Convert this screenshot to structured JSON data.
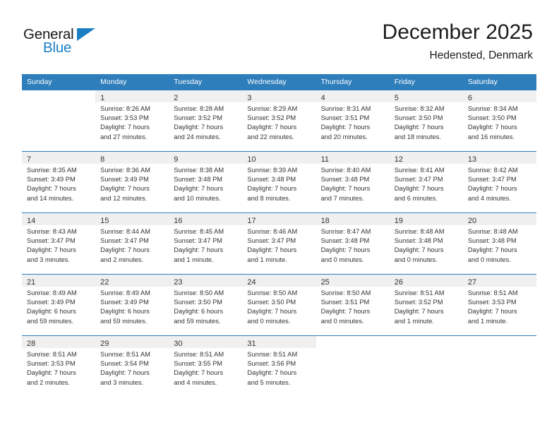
{
  "logo": {
    "word_top": "General",
    "word_bottom": "Blue",
    "triangle_color": "#1c7fc4"
  },
  "header": {
    "title": "December 2025",
    "subtitle": "Hedensted, Denmark"
  },
  "theme": {
    "header_blue": "#2e7ebb",
    "daynum_shade": "#f0f0f0",
    "text": "#333333"
  },
  "weekday_headers": [
    "Sunday",
    "Monday",
    "Tuesday",
    "Wednesday",
    "Thursday",
    "Friday",
    "Saturday"
  ],
  "weeks": [
    [
      {
        "day": "",
        "lines": []
      },
      {
        "day": "1",
        "lines": [
          "Sunrise: 8:26 AM",
          "Sunset: 3:53 PM",
          "Daylight: 7 hours",
          "and 27 minutes."
        ]
      },
      {
        "day": "2",
        "lines": [
          "Sunrise: 8:28 AM",
          "Sunset: 3:52 PM",
          "Daylight: 7 hours",
          "and 24 minutes."
        ]
      },
      {
        "day": "3",
        "lines": [
          "Sunrise: 8:29 AM",
          "Sunset: 3:52 PM",
          "Daylight: 7 hours",
          "and 22 minutes."
        ]
      },
      {
        "day": "4",
        "lines": [
          "Sunrise: 8:31 AM",
          "Sunset: 3:51 PM",
          "Daylight: 7 hours",
          "and 20 minutes."
        ]
      },
      {
        "day": "5",
        "lines": [
          "Sunrise: 8:32 AM",
          "Sunset: 3:50 PM",
          "Daylight: 7 hours",
          "and 18 minutes."
        ]
      },
      {
        "day": "6",
        "lines": [
          "Sunrise: 8:34 AM",
          "Sunset: 3:50 PM",
          "Daylight: 7 hours",
          "and 16 minutes."
        ]
      }
    ],
    [
      {
        "day": "7",
        "lines": [
          "Sunrise: 8:35 AM",
          "Sunset: 3:49 PM",
          "Daylight: 7 hours",
          "and 14 minutes."
        ]
      },
      {
        "day": "8",
        "lines": [
          "Sunrise: 8:36 AM",
          "Sunset: 3:49 PM",
          "Daylight: 7 hours",
          "and 12 minutes."
        ]
      },
      {
        "day": "9",
        "lines": [
          "Sunrise: 8:38 AM",
          "Sunset: 3:48 PM",
          "Daylight: 7 hours",
          "and 10 minutes."
        ]
      },
      {
        "day": "10",
        "lines": [
          "Sunrise: 8:39 AM",
          "Sunset: 3:48 PM",
          "Daylight: 7 hours",
          "and 8 minutes."
        ]
      },
      {
        "day": "11",
        "lines": [
          "Sunrise: 8:40 AM",
          "Sunset: 3:48 PM",
          "Daylight: 7 hours",
          "and 7 minutes."
        ]
      },
      {
        "day": "12",
        "lines": [
          "Sunrise: 8:41 AM",
          "Sunset: 3:47 PM",
          "Daylight: 7 hours",
          "and 6 minutes."
        ]
      },
      {
        "day": "13",
        "lines": [
          "Sunrise: 8:42 AM",
          "Sunset: 3:47 PM",
          "Daylight: 7 hours",
          "and 4 minutes."
        ]
      }
    ],
    [
      {
        "day": "14",
        "lines": [
          "Sunrise: 8:43 AM",
          "Sunset: 3:47 PM",
          "Daylight: 7 hours",
          "and 3 minutes."
        ]
      },
      {
        "day": "15",
        "lines": [
          "Sunrise: 8:44 AM",
          "Sunset: 3:47 PM",
          "Daylight: 7 hours",
          "and 2 minutes."
        ]
      },
      {
        "day": "16",
        "lines": [
          "Sunrise: 8:45 AM",
          "Sunset: 3:47 PM",
          "Daylight: 7 hours",
          "and 1 minute."
        ]
      },
      {
        "day": "17",
        "lines": [
          "Sunrise: 8:46 AM",
          "Sunset: 3:47 PM",
          "Daylight: 7 hours",
          "and 1 minute."
        ]
      },
      {
        "day": "18",
        "lines": [
          "Sunrise: 8:47 AM",
          "Sunset: 3:48 PM",
          "Daylight: 7 hours",
          "and 0 minutes."
        ]
      },
      {
        "day": "19",
        "lines": [
          "Sunrise: 8:48 AM",
          "Sunset: 3:48 PM",
          "Daylight: 7 hours",
          "and 0 minutes."
        ]
      },
      {
        "day": "20",
        "lines": [
          "Sunrise: 8:48 AM",
          "Sunset: 3:48 PM",
          "Daylight: 7 hours",
          "and 0 minutes."
        ]
      }
    ],
    [
      {
        "day": "21",
        "lines": [
          "Sunrise: 8:49 AM",
          "Sunset: 3:49 PM",
          "Daylight: 6 hours",
          "and 59 minutes."
        ]
      },
      {
        "day": "22",
        "lines": [
          "Sunrise: 8:49 AM",
          "Sunset: 3:49 PM",
          "Daylight: 6 hours",
          "and 59 minutes."
        ]
      },
      {
        "day": "23",
        "lines": [
          "Sunrise: 8:50 AM",
          "Sunset: 3:50 PM",
          "Daylight: 6 hours",
          "and 59 minutes."
        ]
      },
      {
        "day": "24",
        "lines": [
          "Sunrise: 8:50 AM",
          "Sunset: 3:50 PM",
          "Daylight: 7 hours",
          "and 0 minutes."
        ]
      },
      {
        "day": "25",
        "lines": [
          "Sunrise: 8:50 AM",
          "Sunset: 3:51 PM",
          "Daylight: 7 hours",
          "and 0 minutes."
        ]
      },
      {
        "day": "26",
        "lines": [
          "Sunrise: 8:51 AM",
          "Sunset: 3:52 PM",
          "Daylight: 7 hours",
          "and 1 minute."
        ]
      },
      {
        "day": "27",
        "lines": [
          "Sunrise: 8:51 AM",
          "Sunset: 3:53 PM",
          "Daylight: 7 hours",
          "and 1 minute."
        ]
      }
    ],
    [
      {
        "day": "28",
        "lines": [
          "Sunrise: 8:51 AM",
          "Sunset: 3:53 PM",
          "Daylight: 7 hours",
          "and 2 minutes."
        ]
      },
      {
        "day": "29",
        "lines": [
          "Sunrise: 8:51 AM",
          "Sunset: 3:54 PM",
          "Daylight: 7 hours",
          "and 3 minutes."
        ]
      },
      {
        "day": "30",
        "lines": [
          "Sunrise: 8:51 AM",
          "Sunset: 3:55 PM",
          "Daylight: 7 hours",
          "and 4 minutes."
        ]
      },
      {
        "day": "31",
        "lines": [
          "Sunrise: 8:51 AM",
          "Sunset: 3:56 PM",
          "Daylight: 7 hours",
          "and 5 minutes."
        ]
      },
      {
        "day": "",
        "lines": []
      },
      {
        "day": "",
        "lines": []
      },
      {
        "day": "",
        "lines": []
      }
    ]
  ]
}
